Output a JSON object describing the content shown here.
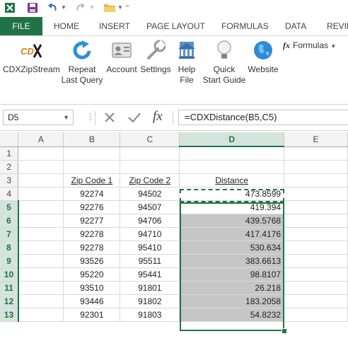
{
  "quick_access": {
    "icons": [
      "excel-logo-icon",
      "save-icon",
      "undo-icon",
      "redo-icon",
      "open-folder-icon",
      "customize-icon"
    ]
  },
  "tabs": [
    {
      "label": "FILE",
      "active": true
    },
    {
      "label": "HOME"
    },
    {
      "label": "INSERT"
    },
    {
      "label": "PAGE LAYOUT"
    },
    {
      "label": "FORMULAS"
    },
    {
      "label": "DATA"
    },
    {
      "label": "REVIE"
    }
  ],
  "ribbon": {
    "buttons": [
      {
        "label": "CDXZipStream",
        "icon": "cdx-logo-icon"
      },
      {
        "label": "Repeat\nLast Query",
        "icon": "repeat-icon"
      },
      {
        "label": "Account",
        "icon": "account-card-icon"
      },
      {
        "label": "Settings",
        "icon": "wrench-icon"
      },
      {
        "label": "Help\nFile",
        "icon": "help-file-icon"
      },
      {
        "label": "Quick\nStart Guide",
        "icon": "lightbulb-icon"
      },
      {
        "label": "Website",
        "icon": "globe-icon"
      }
    ],
    "formulas_menu": {
      "icon": "fx",
      "label": "Formulas"
    }
  },
  "formula_bar": {
    "name_box": "D5",
    "function_icon": "fx",
    "formula": "=CDXDistance(B5,C5)"
  },
  "sheet": {
    "columns": [
      "A",
      "B",
      "C",
      "D",
      "E"
    ],
    "selected_column": "D",
    "header_row": {
      "row": "3",
      "b": "Zip Code 1",
      "c": "Zip Code 2",
      "d": "Distance"
    },
    "rows": [
      {
        "row": "1",
        "b": "",
        "c": "",
        "d": ""
      },
      {
        "row": "2",
        "b": "",
        "c": "",
        "d": ""
      },
      {
        "row": "4",
        "b": "92274",
        "c": "94502",
        "d": "473.8599"
      },
      {
        "row": "5",
        "b": "92276",
        "c": "94507",
        "d": "419.394"
      },
      {
        "row": "6",
        "b": "92277",
        "c": "94706",
        "d": "439.5768"
      },
      {
        "row": "7",
        "b": "92278",
        "c": "94710",
        "d": "417.4176"
      },
      {
        "row": "8",
        "b": "92278",
        "c": "95410",
        "d": "530.634"
      },
      {
        "row": "9",
        "b": "93526",
        "c": "95511",
        "d": "383.6613"
      },
      {
        "row": "10",
        "b": "95220",
        "c": "95441",
        "d": "98.8107"
      },
      {
        "row": "11",
        "b": "93510",
        "c": "91801",
        "d": "26.218"
      },
      {
        "row": "12",
        "b": "93446",
        "c": "91802",
        "d": "183.2058"
      },
      {
        "row": "13",
        "b": "92301",
        "c": "91803",
        "d": "54.8232"
      }
    ]
  },
  "colors": {
    "excel_green": "#217346",
    "selection_gray": "#c6c6c6"
  }
}
